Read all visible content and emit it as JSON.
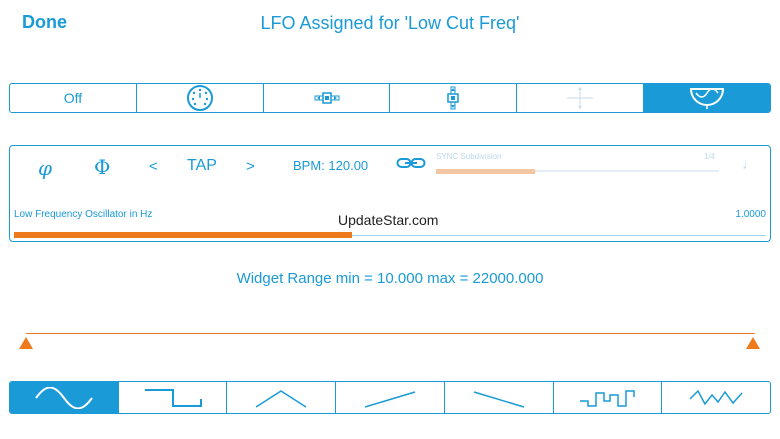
{
  "header": {
    "done_label": "Done",
    "title": "LFO Assigned for 'Low Cut Freq'"
  },
  "mode_selector": {
    "items": [
      {
        "label": "Off",
        "icon": null,
        "active": false
      },
      {
        "label": "",
        "icon": "dial-knob-icon",
        "active": false
      },
      {
        "label": "",
        "icon": "horizontal-slider-icon",
        "active": false
      },
      {
        "label": "",
        "icon": "vertical-slider-icon",
        "active": false
      },
      {
        "label": "",
        "icon": "crosshair-icon",
        "active": false
      },
      {
        "label": "",
        "icon": "lfo-gauge-icon",
        "active": true
      }
    ]
  },
  "lfo_panel": {
    "phase_icon_1": "φ",
    "phase_icon_2": "Φ",
    "prev_label": "<",
    "tap_label": "TAP",
    "next_label": ">",
    "bpm_label": "BPM: 120.00",
    "link_icon": "link-icon",
    "sync_label": "SYNC Subdivision",
    "sync_value": "1/4",
    "sync_fraction": 0.35,
    "note_glyph": "♩",
    "oscillator_label": "Low Frequency Oscillator in Hz",
    "oscillator_value": "1.0000",
    "oscillator_fraction": 0.45
  },
  "watermark": "UpdateStar.com",
  "range": {
    "text": "Widget Range min = 10.000 max = 22000.000"
  },
  "waveforms": {
    "items": [
      {
        "icon": "sine-wave-icon",
        "active": true
      },
      {
        "icon": "square-wave-icon",
        "active": false
      },
      {
        "icon": "triangle-wave-icon",
        "active": false
      },
      {
        "icon": "saw-up-wave-icon",
        "active": false
      },
      {
        "icon": "saw-down-wave-icon",
        "active": false
      },
      {
        "icon": "stepped-random-wave-icon",
        "active": false
      },
      {
        "icon": "random-wave-icon",
        "active": false
      }
    ]
  },
  "colors": {
    "accent": "#1a9ad6",
    "orange": "#ee7a1e",
    "background": "#ffffff"
  }
}
